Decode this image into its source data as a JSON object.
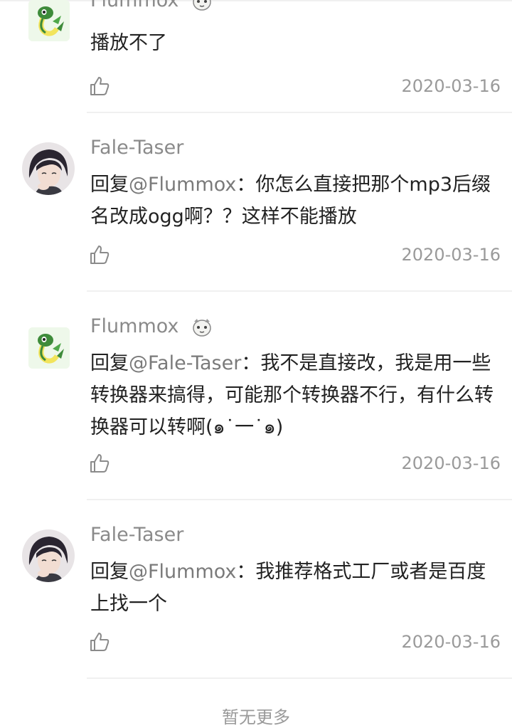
{
  "comments": [
    {
      "username": "Flummox",
      "has_badge": true,
      "avatar": "snake-avatar",
      "reply_prefix": "",
      "mention": "",
      "text": "播放不了",
      "date": "2020-03-16"
    },
    {
      "username": "Fale-Taser",
      "has_badge": false,
      "avatar": "anime-avatar",
      "reply_prefix": "回复",
      "mention": "@Flummox",
      "text": "：你怎么直接把那个mp3后缀名改成ogg啊？？这样不能播放",
      "date": "2020-03-16"
    },
    {
      "username": "Flummox",
      "has_badge": true,
      "avatar": "snake-avatar",
      "reply_prefix": "回复",
      "mention": "@Fale-Taser",
      "text": "：我不是直接改，我是用一些转换器来搞得，可能那个转换器不行，有什么转换器可以转啊(๑˙一˙๑)",
      "date": "2020-03-16"
    },
    {
      "username": "Fale-Taser",
      "has_badge": false,
      "avatar": "anime-avatar",
      "reply_prefix": "回复",
      "mention": "@Flummox",
      "text": "：我推荐格式工厂或者是百度上找一个",
      "date": "2020-03-16"
    }
  ],
  "footer": {
    "no_more": "暂无更多"
  },
  "colors": {
    "username": "#8a8a8a",
    "mention": "#7a7a7a",
    "date": "#9a9a9a",
    "divider": "#f0f0f0"
  }
}
